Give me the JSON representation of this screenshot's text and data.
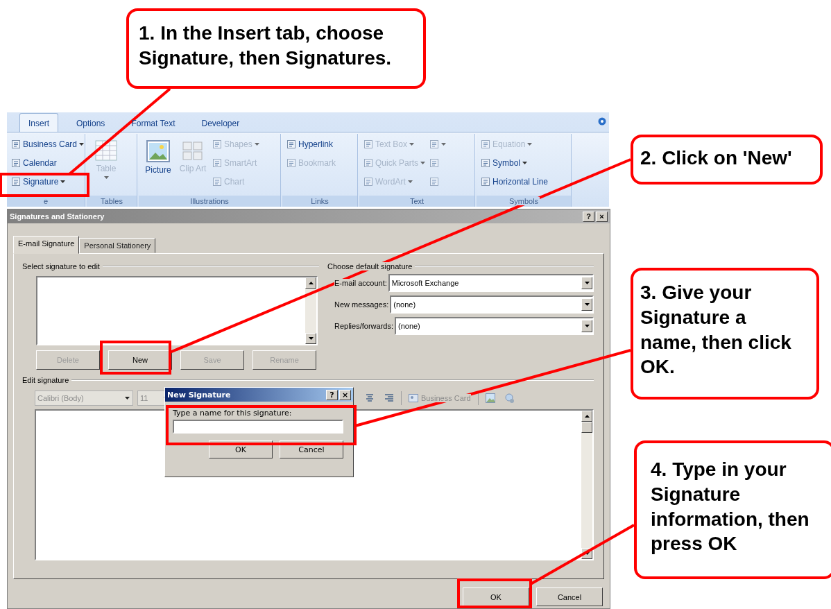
{
  "callouts": [
    {
      "text": "1. In the Insert tab, choose Signature, then Signatures."
    },
    {
      "text": "2. Click on 'New'"
    },
    {
      "text": "3. Give your Signature a name, then click OK."
    },
    {
      "text": "4. Type in your Signature information, then press OK"
    }
  ],
  "ribbon": {
    "tabs": [
      {
        "label": "Insert",
        "selected": true
      },
      {
        "label": "Options",
        "selected": false
      },
      {
        "label": "Format Text",
        "selected": false
      },
      {
        "label": "Developer",
        "selected": false
      }
    ],
    "groups": [
      {
        "label": "e",
        "columns": [
          {
            "kind": "stack",
            "items": [
              {
                "label": "Business Card",
                "dropdown": true,
                "disabled": false
              },
              {
                "label": "Calendar",
                "dropdown": false,
                "disabled": false
              },
              {
                "label": "Signature",
                "dropdown": true,
                "disabled": false
              }
            ]
          }
        ]
      },
      {
        "label": "Tables",
        "columns": [
          {
            "kind": "large",
            "items": [
              {
                "label": "Table",
                "dropdown": true,
                "disabled": true
              }
            ]
          }
        ]
      },
      {
        "label": "Illustrations",
        "columns": [
          {
            "kind": "large",
            "items": [
              {
                "label": "Picture",
                "dropdown": false,
                "disabled": false
              }
            ]
          },
          {
            "kind": "large",
            "items": [
              {
                "label": "Clip Art",
                "dropdown": false,
                "disabled": true
              }
            ]
          },
          {
            "kind": "stack",
            "items": [
              {
                "label": "Shapes",
                "dropdown": true,
                "disabled": true
              },
              {
                "label": "SmartArt",
                "dropdown": false,
                "disabled": true
              },
              {
                "label": "Chart",
                "dropdown": false,
                "disabled": true
              }
            ]
          }
        ]
      },
      {
        "label": "Links",
        "columns": [
          {
            "kind": "stack",
            "items": [
              {
                "label": "Hyperlink",
                "dropdown": false,
                "disabled": false
              },
              {
                "label": "Bookmark",
                "dropdown": false,
                "disabled": true
              }
            ]
          }
        ]
      },
      {
        "label": "Text",
        "columns": [
          {
            "kind": "stack",
            "items": [
              {
                "label": "Text Box",
                "dropdown": true,
                "disabled": true
              },
              {
                "label": "Quick Parts",
                "dropdown": true,
                "disabled": true
              },
              {
                "label": "WordArt",
                "dropdown": true,
                "disabled": true
              }
            ]
          },
          {
            "kind": "stack",
            "items": [
              {
                "dropdown": true,
                "disabled": true
              },
              {
                "dropdown": false,
                "disabled": true
              },
              {
                "dropdown": false,
                "disabled": true
              }
            ]
          }
        ]
      },
      {
        "label": "Symbols",
        "columns": [
          {
            "kind": "stack",
            "items": [
              {
                "label": "Equation",
                "dropdown": true,
                "disabled": true
              },
              {
                "label": "Symbol",
                "dropdown": true,
                "disabled": false
              },
              {
                "label": "Horizontal Line",
                "dropdown": false,
                "disabled": false
              }
            ]
          }
        ]
      }
    ]
  },
  "dialog": {
    "title": "Signatures and Stationery",
    "help": "?",
    "close": "×",
    "tabs": [
      {
        "label": "E-mail Signature",
        "selected": true
      },
      {
        "label": "Personal Stationery",
        "selected": false
      }
    ],
    "select_section": {
      "label": "Select signature to edit",
      "buttons": [
        {
          "label": "Delete",
          "disabled": true
        },
        {
          "label": "New",
          "disabled": false
        },
        {
          "label": "Save",
          "disabled": true
        },
        {
          "label": "Rename",
          "disabled": true
        }
      ]
    },
    "default_section": {
      "label": "Choose default signature",
      "fields": [
        {
          "label": "E-mail account:",
          "value": "Microsoft Exchange"
        },
        {
          "label": "New messages:",
          "value": "(none)"
        },
        {
          "label": "Replies/forwards:",
          "value": "(none)"
        }
      ]
    },
    "edit_section": {
      "label": "Edit signature",
      "font": "Calibri (Body)",
      "size": "11",
      "business_card": "Business Card"
    },
    "buttons": [
      {
        "label": "OK"
      },
      {
        "label": "Cancel"
      }
    ]
  },
  "new_signature": {
    "title": "New Signature",
    "help": "?",
    "close": "×",
    "label": "Type a name for this signature:",
    "buttons": [
      {
        "label": "OK"
      },
      {
        "label": "Cancel"
      }
    ]
  }
}
